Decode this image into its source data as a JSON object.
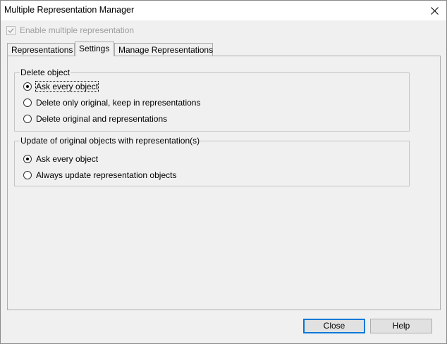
{
  "window": {
    "title": "Multiple Representation Manager",
    "close_icon": "close-icon"
  },
  "enable_multiple": {
    "label": "Enable multiple representation",
    "checked": true,
    "disabled": true
  },
  "tabs": [
    {
      "label": "Representations",
      "active": false
    },
    {
      "label": "Settings",
      "active": true
    },
    {
      "label": "Manage Representations",
      "active": false
    }
  ],
  "delete_group": {
    "legend": "Delete object",
    "options": [
      {
        "label": "Ask every object",
        "checked": true
      },
      {
        "label": "Delete only original, keep in representations",
        "checked": false
      },
      {
        "label": "Delete original and representations",
        "checked": false
      }
    ]
  },
  "update_group": {
    "legend": "Update of original objects with representation(s)",
    "options": [
      {
        "label": "Ask every object",
        "checked": true
      },
      {
        "label": "Always update representation objects",
        "checked": false
      }
    ]
  },
  "buttons": {
    "close_label": "Close",
    "help_label": "Help"
  }
}
